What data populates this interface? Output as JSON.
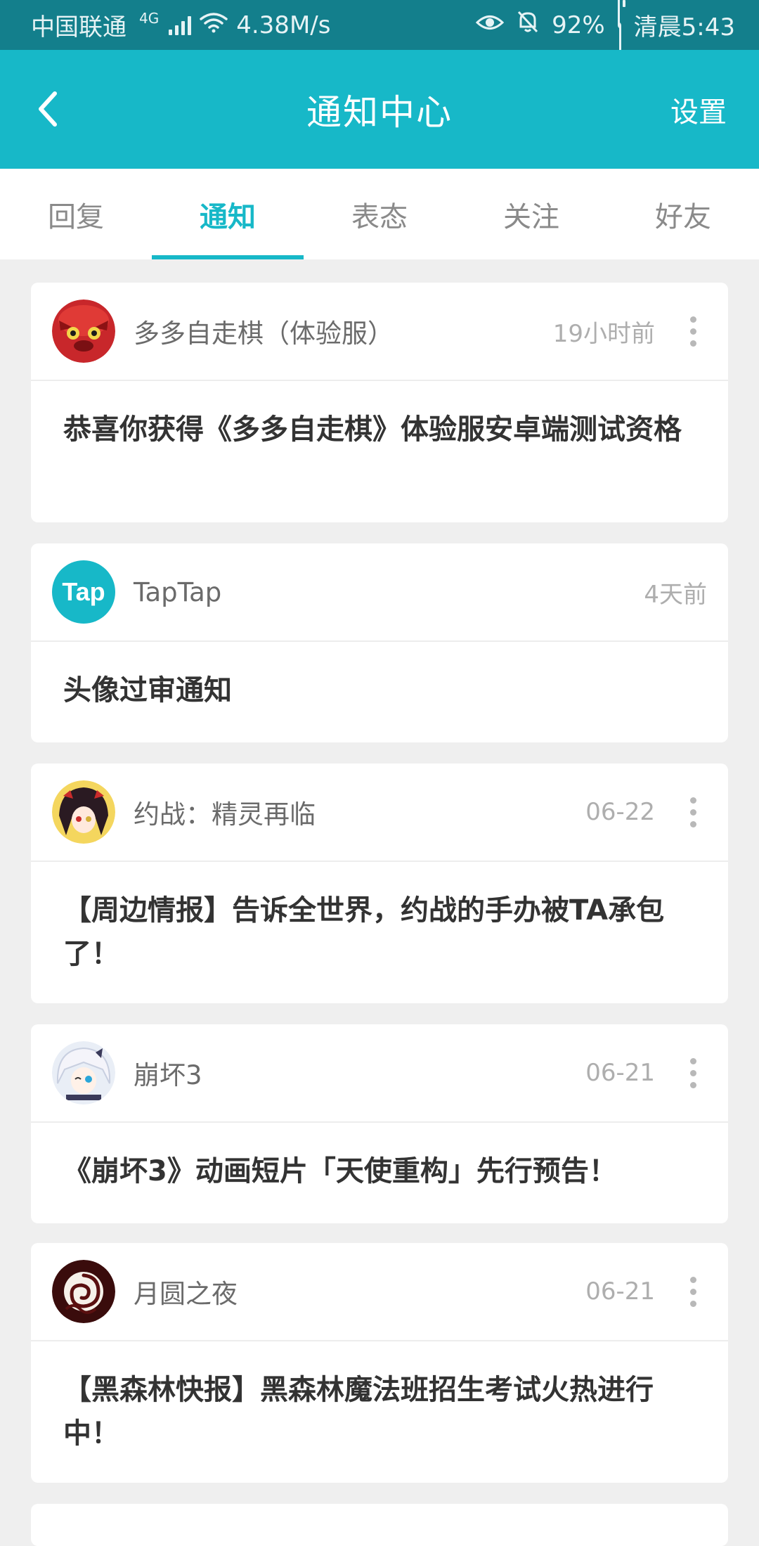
{
  "status_bar": {
    "carrier": "中国联通",
    "network_type": "4G",
    "speed": "4.38M/s",
    "battery": "92%",
    "time": "清晨5:43"
  },
  "header": {
    "title": "通知中心",
    "settings_label": "设置"
  },
  "tabs": [
    {
      "label": "回复",
      "active": false
    },
    {
      "label": "通知",
      "active": true
    },
    {
      "label": "表态",
      "active": false
    },
    {
      "label": "关注",
      "active": false
    },
    {
      "label": "好友",
      "active": false
    }
  ],
  "notifications": [
    {
      "source": "多多自走棋（体验服）",
      "time": "19小时前",
      "message": "恭喜你获得《多多自走棋》体验服安卓端测试资格",
      "avatar": "red-creature-avatar"
    },
    {
      "source": "TapTap",
      "time": "4天前",
      "message": "头像过审通知",
      "avatar_text": "Tap"
    },
    {
      "source": "约战：精灵再临",
      "time": "06-22",
      "message": "【周边情报】告诉全世界，约战的手办被TA承包了！",
      "avatar": "anime-girl-avatar"
    },
    {
      "source": "崩坏3",
      "time": "06-21",
      "message": "《崩坏3》动画短片「天使重构」先行预告！",
      "avatar": "anime-girl-avatar"
    },
    {
      "source": "月圆之夜",
      "time": "06-21",
      "message": "【黑森林快报】黑森林魔法班招生考试火热进行中！",
      "avatar": "moon-swirl-avatar"
    }
  ],
  "colors": {
    "accent": "#17b8c8",
    "status_bar": "#137f8c",
    "background": "#efefef"
  }
}
